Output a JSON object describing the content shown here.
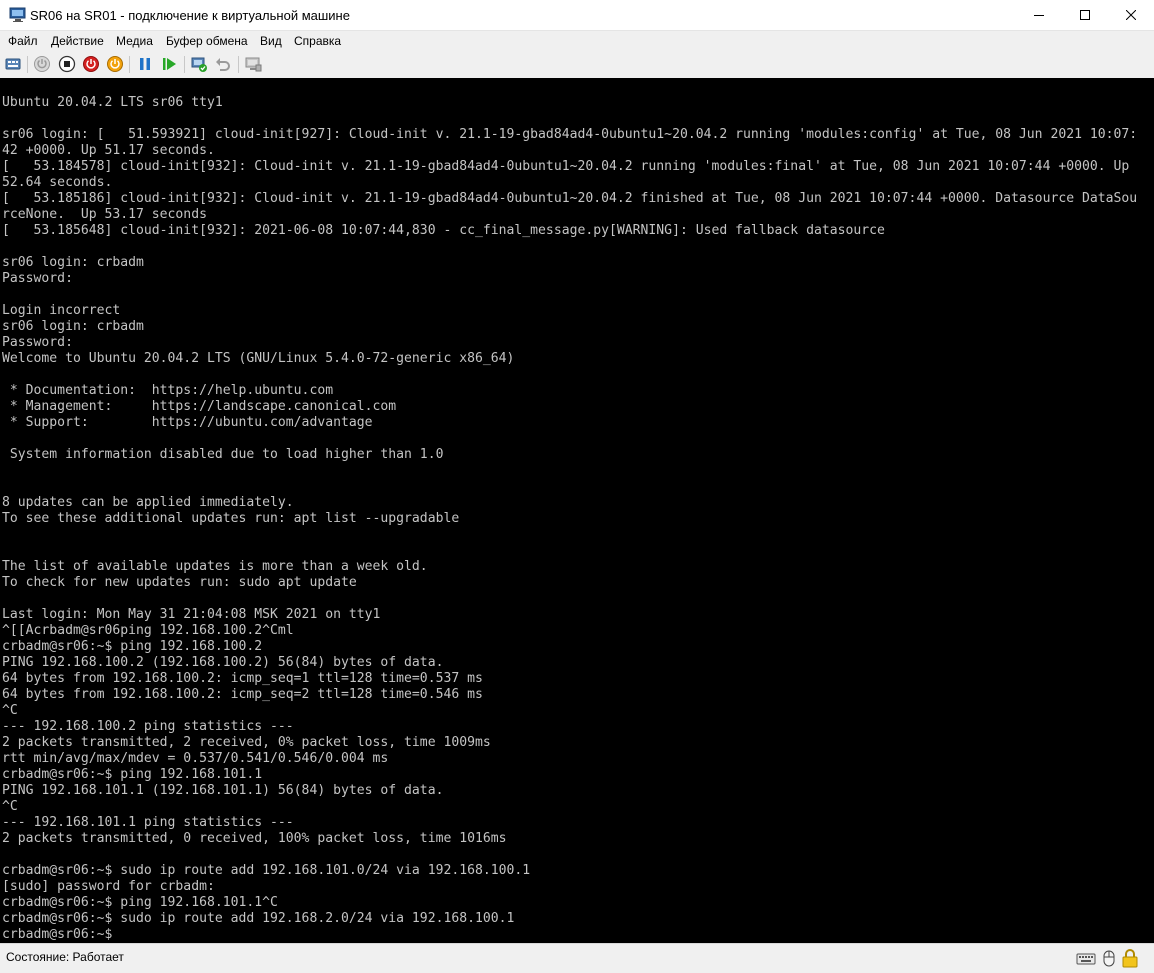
{
  "window": {
    "title": "SR06 на SR01 - подключение к виртуальной машине"
  },
  "menu": {
    "items": [
      "Файл",
      "Действие",
      "Медиа",
      "Буфер обмена",
      "Вид",
      "Справка"
    ]
  },
  "toolbar": {
    "icons": [
      "ctrl-alt-del-icon",
      "start-icon",
      "turn-off-icon",
      "shutdown-icon",
      "save-state-icon",
      "pause-icon",
      "reset-icon",
      "checkpoint-icon",
      "revert-icon",
      "enhanced-session-icon"
    ]
  },
  "console": {
    "lines": [
      "Ubuntu 20.04.2 LTS sr06 tty1",
      "",
      "sr06 login: [   51.593921] cloud-init[927]: Cloud-init v. 21.1-19-gbad84ad4-0ubuntu1~20.04.2 running 'modules:config' at Tue, 08 Jun 2021 10:07:",
      "42 +0000. Up 51.17 seconds.",
      "[   53.184578] cloud-init[932]: Cloud-init v. 21.1-19-gbad84ad4-0ubuntu1~20.04.2 running 'modules:final' at Tue, 08 Jun 2021 10:07:44 +0000. Up",
      "52.64 seconds.",
      "[   53.185186] cloud-init[932]: Cloud-init v. 21.1-19-gbad84ad4-0ubuntu1~20.04.2 finished at Tue, 08 Jun 2021 10:07:44 +0000. Datasource DataSou",
      "rceNone.  Up 53.17 seconds",
      "[   53.185648] cloud-init[932]: 2021-06-08 10:07:44,830 - cc_final_message.py[WARNING]: Used fallback datasource",
      "",
      "sr06 login: crbadm",
      "Password:",
      "",
      "Login incorrect",
      "sr06 login: crbadm",
      "Password:",
      "Welcome to Ubuntu 20.04.2 LTS (GNU/Linux 5.4.0-72-generic x86_64)",
      "",
      " * Documentation:  https://help.ubuntu.com",
      " * Management:     https://landscape.canonical.com",
      " * Support:        https://ubuntu.com/advantage",
      "",
      " System information disabled due to load higher than 1.0",
      "",
      "",
      "8 updates can be applied immediately.",
      "To see these additional updates run: apt list --upgradable",
      "",
      "",
      "The list of available updates is more than a week old.",
      "To check for new updates run: sudo apt update",
      "",
      "Last login: Mon May 31 21:04:08 MSK 2021 on tty1",
      "^[[Acrbadm@sr06ping 192.168.100.2^Cml",
      "crbadm@sr06:~$ ping 192.168.100.2",
      "PING 192.168.100.2 (192.168.100.2) 56(84) bytes of data.",
      "64 bytes from 192.168.100.2: icmp_seq=1 ttl=128 time=0.537 ms",
      "64 bytes from 192.168.100.2: icmp_seq=2 ttl=128 time=0.546 ms",
      "^C",
      "--- 192.168.100.2 ping statistics ---",
      "2 packets transmitted, 2 received, 0% packet loss, time 1009ms",
      "rtt min/avg/max/mdev = 0.537/0.541/0.546/0.004 ms",
      "crbadm@sr06:~$ ping 192.168.101.1",
      "PING 192.168.101.1 (192.168.101.1) 56(84) bytes of data.",
      "^C",
      "--- 192.168.101.1 ping statistics ---",
      "2 packets transmitted, 0 received, 100% packet loss, time 1016ms",
      "",
      "crbadm@sr06:~$ sudo ip route add 192.168.101.0/24 via 192.168.100.1",
      "[sudo] password for crbadm:",
      "crbadm@sr06:~$ ping 192.168.101.1^C",
      "crbadm@sr06:~$ sudo ip route add 192.168.2.0/24 via 192.168.100.1",
      "crbadm@sr06:~$ "
    ]
  },
  "statusbar": {
    "status": "Состояние: Работает",
    "icons": [
      "keyboard-icon",
      "mouse-icon",
      "lock-icon"
    ]
  },
  "colors": {
    "console_bg": "#000000",
    "console_fg": "#c4c4c4",
    "chrome_bg": "#f0f0f0"
  }
}
